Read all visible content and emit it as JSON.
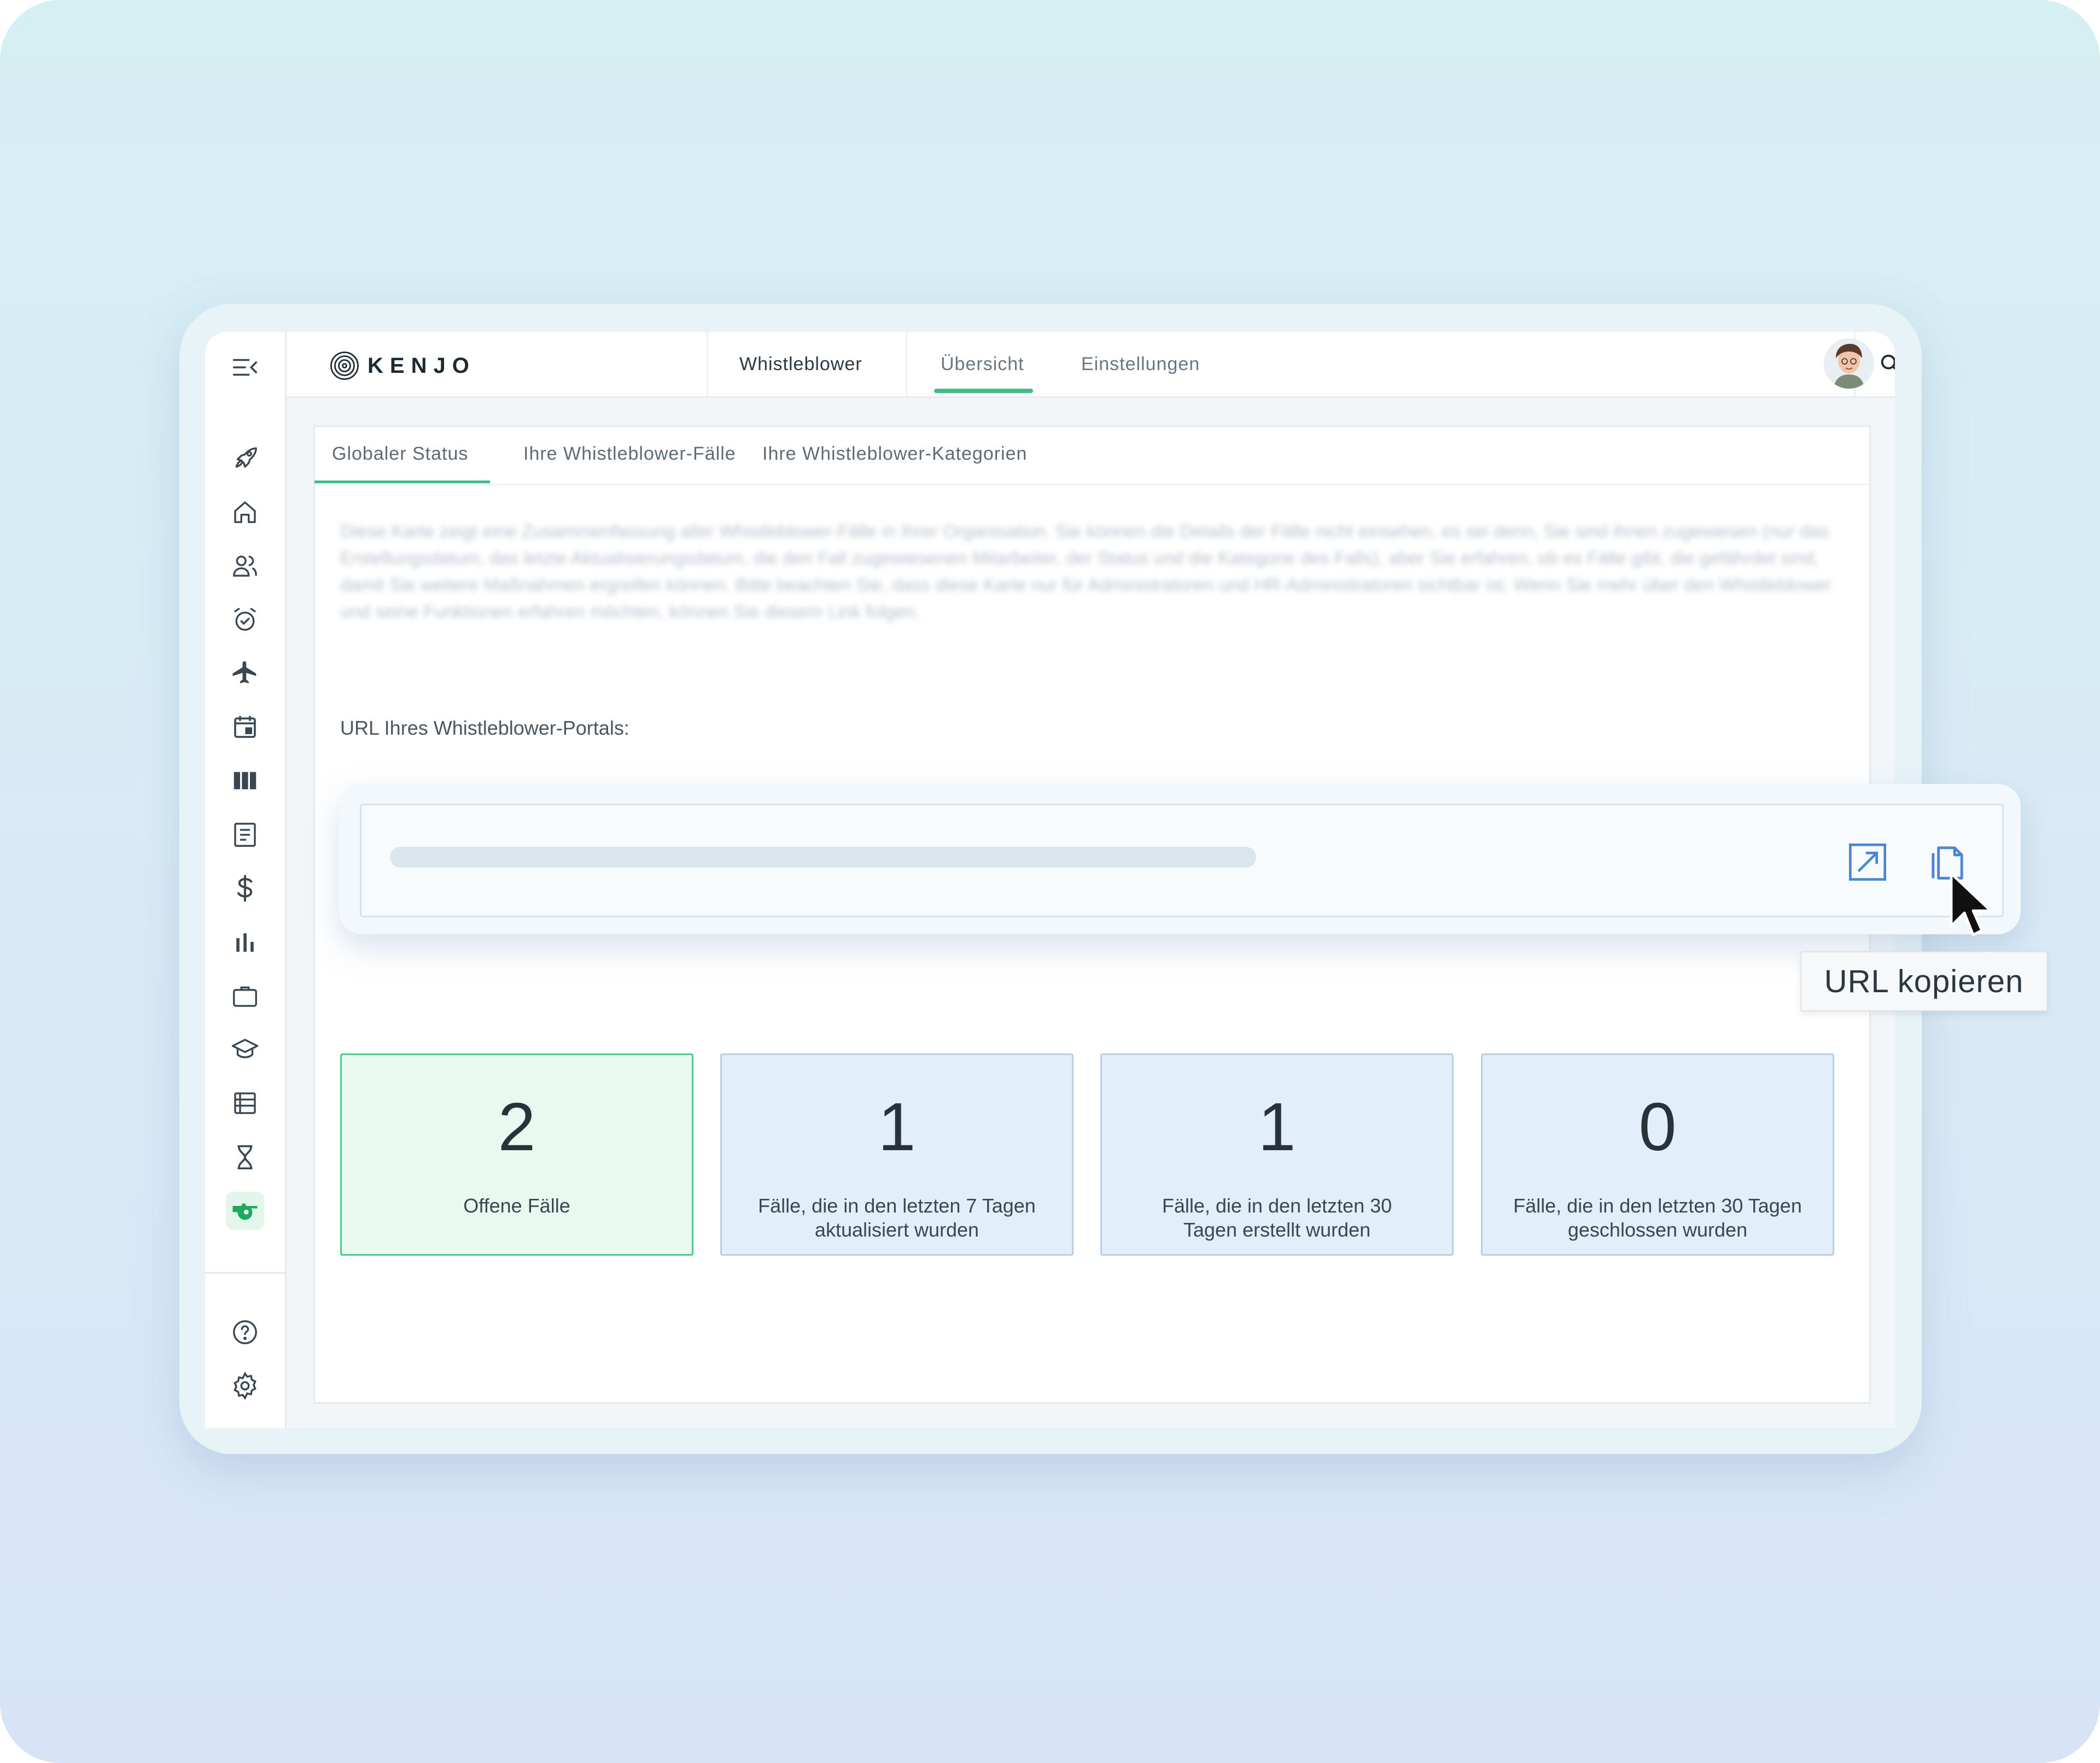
{
  "brand": {
    "logo_text": "KENJO"
  },
  "topbar": {
    "section": "Whistleblower",
    "tabs": [
      {
        "label": "Übersicht",
        "active": true
      },
      {
        "label": "Einstellungen",
        "active": false
      }
    ],
    "icons": [
      "search-icon",
      "bolt-icon",
      "bell-icon",
      "user-avatar"
    ]
  },
  "sidebar": {
    "icons": [
      "menu-collapse-icon",
      "rocket-icon",
      "home-icon",
      "people-icon",
      "alarm-icon",
      "plane-icon",
      "calendar-icon",
      "columns-icon",
      "document-icon",
      "dollar-icon",
      "bar-chart-icon",
      "briefcase-icon",
      "graduation-cap-icon",
      "list-icon",
      "hourglass-icon",
      "whistle-icon",
      "help-icon",
      "settings-icon"
    ],
    "active_icon": "whistle-icon"
  },
  "subtabs": [
    {
      "label": "Globaler Status",
      "active": true
    },
    {
      "label": "Ihre Whistleblower-Fälle",
      "active": false
    },
    {
      "label": "Ihre Whistleblower-Kategorien",
      "active": false
    }
  ],
  "description_blurred": "Diese Karte zeigt eine Zusammenfassung aller Whistleblower-Fälle in Ihrer Organisation. Sie können die Details der Fälle nicht einsehen, es sei denn, Sie sind ihnen zugewiesen (nur das Erstellungsdatum, das letzte Aktualisierungsdatum, die den Fall zugewiesenen Mitarbeiter, der Status und die Kategorie des Falls), aber Sie erfahren, ob es Fälle gibt, die gefährdet sind, damit Sie weitere Maßnahmen ergreifen können. Bitte beachten Sie, dass diese Karte nur für Administratoren und HR-Administratoren sichtbar ist. Wenn Sie mehr über den Whistleblower und seine Funktionen erfahren möchten, können Sie diesem Link folgen.",
  "url_section": {
    "label": "URL Ihres Whistleblower-Portals:",
    "tooltip": "URL kopieren"
  },
  "stats": [
    {
      "value": "2",
      "label": "Offene Fälle",
      "accent": "#4ec98a"
    },
    {
      "value": "1",
      "label_line1": "Fälle, die in den letzten 7 Tagen",
      "label_line2": "aktualisiert wurden",
      "accent": "#b9cde6"
    },
    {
      "value": "1",
      "label_line1": "Fälle, die in den letzten 30",
      "label_line2": "Tagen erstellt wurden",
      "accent": "#b9cde6"
    },
    {
      "value": "0",
      "label_line1": "Fälle, die in den letzten 30 Tagen",
      "label_line2": "geschlossen wurden",
      "accent": "#b9cde6"
    }
  ],
  "colors": {
    "primary_green": "#3fbf86",
    "link_blue": "#4a86d4",
    "background": "#d6eff3"
  }
}
